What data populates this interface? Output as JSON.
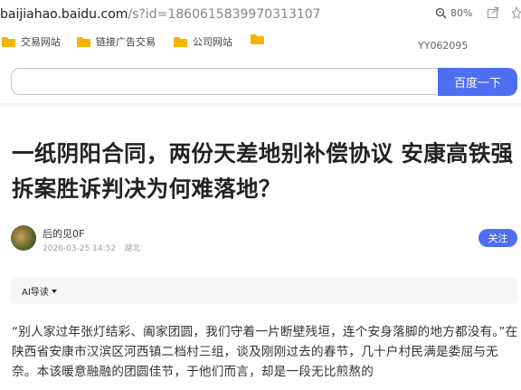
{
  "browser": {
    "url_host": "baijiahao.baidu.com",
    "url_path": "/s?id=1860615839970313107",
    "zoom": "80%"
  },
  "bookmarks": [
    {
      "label": "交易网站"
    },
    {
      "label": "链接广告交易"
    },
    {
      "label": "公司网站"
    },
    {
      "label": ""
    }
  ],
  "bookmarks_code": "YY062095",
  "search": {
    "value": "",
    "button_label": "百度一下"
  },
  "article": {
    "title": "一纸阴阳合同，两份天差地别补偿协议 安康高铁强拆案胜诉判决为何难落地？",
    "author": "后的见0F",
    "date": "2026-03-25 14:52",
    "location": "湖北",
    "follow_label": "关注",
    "ai_label": "AI导读",
    "paragraph": "“别人家过年张灯结彩、阖家团圆，我们守着一片断壁残垣，连个安身落脚的地方都没有。”在陕西省安康市汉滨区河西镇二档村三组，谈及刚刚过去的春节，几十户村民满是委屈与无奈。本该暖意融融的团圆佳节，于他们而言，却是一段无比煎熬的"
  },
  "colors": {
    "accent": "#4e6ef2",
    "folder": "#f4b400"
  }
}
